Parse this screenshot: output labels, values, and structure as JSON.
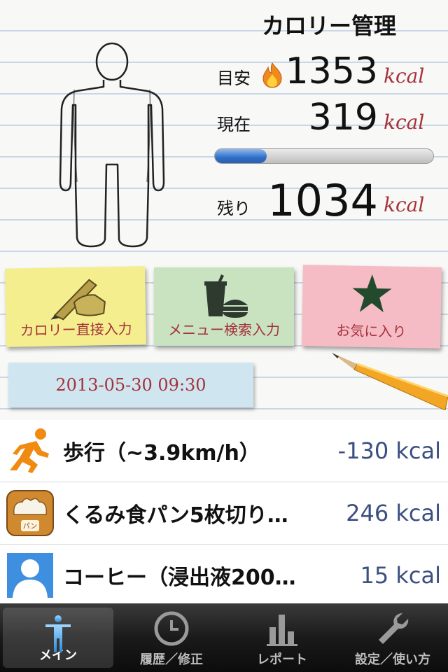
{
  "header": {
    "title": "カロリー管理",
    "target_label": "目安",
    "target_value": "1353",
    "current_label": "現在",
    "current_value": "319",
    "remaining_label": "残り",
    "remaining_value": "1034",
    "unit": "kcal",
    "progress_fraction": 0.236
  },
  "actions": {
    "direct_input": "カロリー直接入力",
    "menu_search": "メニュー検索入力",
    "favorites": "お気に入り"
  },
  "datetime": "2013-05-30 09:30",
  "entries": [
    {
      "name": "歩行（~3.9km/h）",
      "kcal": "-130 kcal",
      "icon": "running-icon"
    },
    {
      "name": "くるみ食パン5枚切り…",
      "kcal": "246 kcal",
      "icon": "bread-icon",
      "icon_label": "パン"
    },
    {
      "name": "コーヒー（浸出液200…",
      "kcal": "15 kcal",
      "icon": "person-placeholder-icon"
    }
  ],
  "tabs": [
    {
      "label": "メイン",
      "icon": "person-icon",
      "active": true
    },
    {
      "label": "履歴／修正",
      "icon": "clock-icon",
      "active": false
    },
    {
      "label": "レポート",
      "icon": "bar-chart-icon",
      "active": false
    },
    {
      "label": "設定／使い方",
      "icon": "wrench-icon",
      "active": false
    }
  ],
  "colors": {
    "accent_red": "#a5323a",
    "kcal_blue": "#3b4f80",
    "progress_blue": "#2f6fc8"
  }
}
